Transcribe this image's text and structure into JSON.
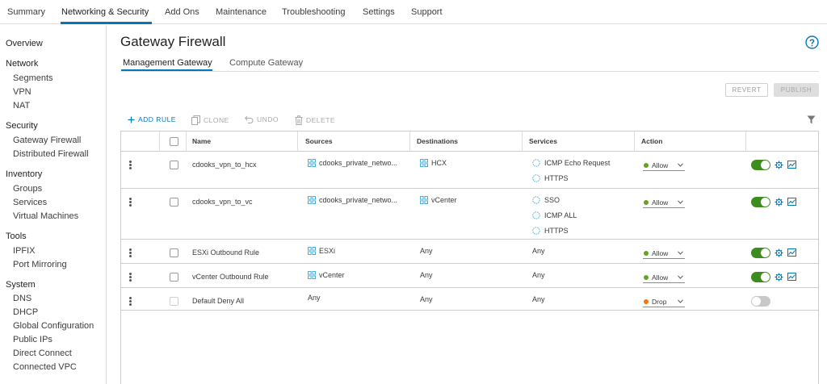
{
  "topnav": {
    "tabs": [
      {
        "label": "Summary"
      },
      {
        "label": "Networking & Security"
      },
      {
        "label": "Add Ons"
      },
      {
        "label": "Maintenance"
      },
      {
        "label": "Troubleshooting"
      },
      {
        "label": "Settings"
      },
      {
        "label": "Support"
      }
    ],
    "active_index": 1
  },
  "sidebar": {
    "overview": "Overview",
    "sections": [
      {
        "title": "Network",
        "items": [
          "Segments",
          "VPN",
          "NAT"
        ]
      },
      {
        "title": "Security",
        "items": [
          "Gateway Firewall",
          "Distributed Firewall"
        ]
      },
      {
        "title": "Inventory",
        "items": [
          "Groups",
          "Services",
          "Virtual Machines"
        ]
      },
      {
        "title": "Tools",
        "items": [
          "IPFIX",
          "Port Mirroring"
        ]
      },
      {
        "title": "System",
        "items": [
          "DNS",
          "DHCP",
          "Global Configuration",
          "Public IPs",
          "Direct Connect",
          "Connected VPC"
        ]
      }
    ]
  },
  "page": {
    "title": "Gateway Firewall",
    "subtabs": [
      "Management Gateway",
      "Compute Gateway"
    ],
    "active_subtab": 0,
    "revert_label": "REVERT",
    "publish_label": "PUBLISH"
  },
  "toolbar": {
    "add_rule": "ADD RULE",
    "clone": "CLONE",
    "undo": "UNDO",
    "delete": "DELETE"
  },
  "table": {
    "columns": {
      "name": "Name",
      "sources": "Sources",
      "destinations": "Destinations",
      "services": "Services",
      "action": "Action"
    },
    "rows": [
      {
        "name": "cdooks_vpn_to_hcx",
        "source": "cdooks_private_netwo...",
        "source_is_group": true,
        "destination": "HCX",
        "destination_is_group": true,
        "services": [
          "ICMP Echo Request",
          "HTTPS"
        ],
        "services_are_objects": true,
        "action": "Allow",
        "enabled": true,
        "checkbox_enabled": true,
        "has_icons": true
      },
      {
        "name": "cdooks_vpn_to_vc",
        "source": "cdooks_private_netwo...",
        "source_is_group": true,
        "destination": "vCenter",
        "destination_is_group": true,
        "services": [
          "SSO",
          "ICMP ALL",
          "HTTPS"
        ],
        "services_are_objects": true,
        "action": "Allow",
        "enabled": true,
        "checkbox_enabled": true,
        "has_icons": true
      },
      {
        "name": "ESXi Outbound Rule",
        "source": "ESXi",
        "source_is_group": true,
        "destination": "Any",
        "destination_is_group": false,
        "services": [
          "Any"
        ],
        "services_are_objects": false,
        "action": "Allow",
        "enabled": true,
        "checkbox_enabled": true,
        "has_icons": true
      },
      {
        "name": "vCenter Outbound Rule",
        "source": "vCenter",
        "source_is_group": true,
        "destination": "Any",
        "destination_is_group": false,
        "services": [
          "Any"
        ],
        "services_are_objects": false,
        "action": "Allow",
        "enabled": true,
        "checkbox_enabled": true,
        "has_icons": true
      },
      {
        "name": "Default Deny All",
        "source": "Any",
        "source_is_group": false,
        "destination": "Any",
        "destination_is_group": false,
        "services": [
          "Any"
        ],
        "services_are_objects": false,
        "action": "Drop",
        "enabled": false,
        "checkbox_enabled": false,
        "has_icons": false
      }
    ]
  },
  "colors": {
    "accent": "#0079b8",
    "allow": "#62a420",
    "drop": "#f57600",
    "toggle_on": "#3c8d1e",
    "toggle_off": "#c8c8c8",
    "icon_teal": "#49afd9",
    "disabled_text": "#9a9a9a"
  }
}
